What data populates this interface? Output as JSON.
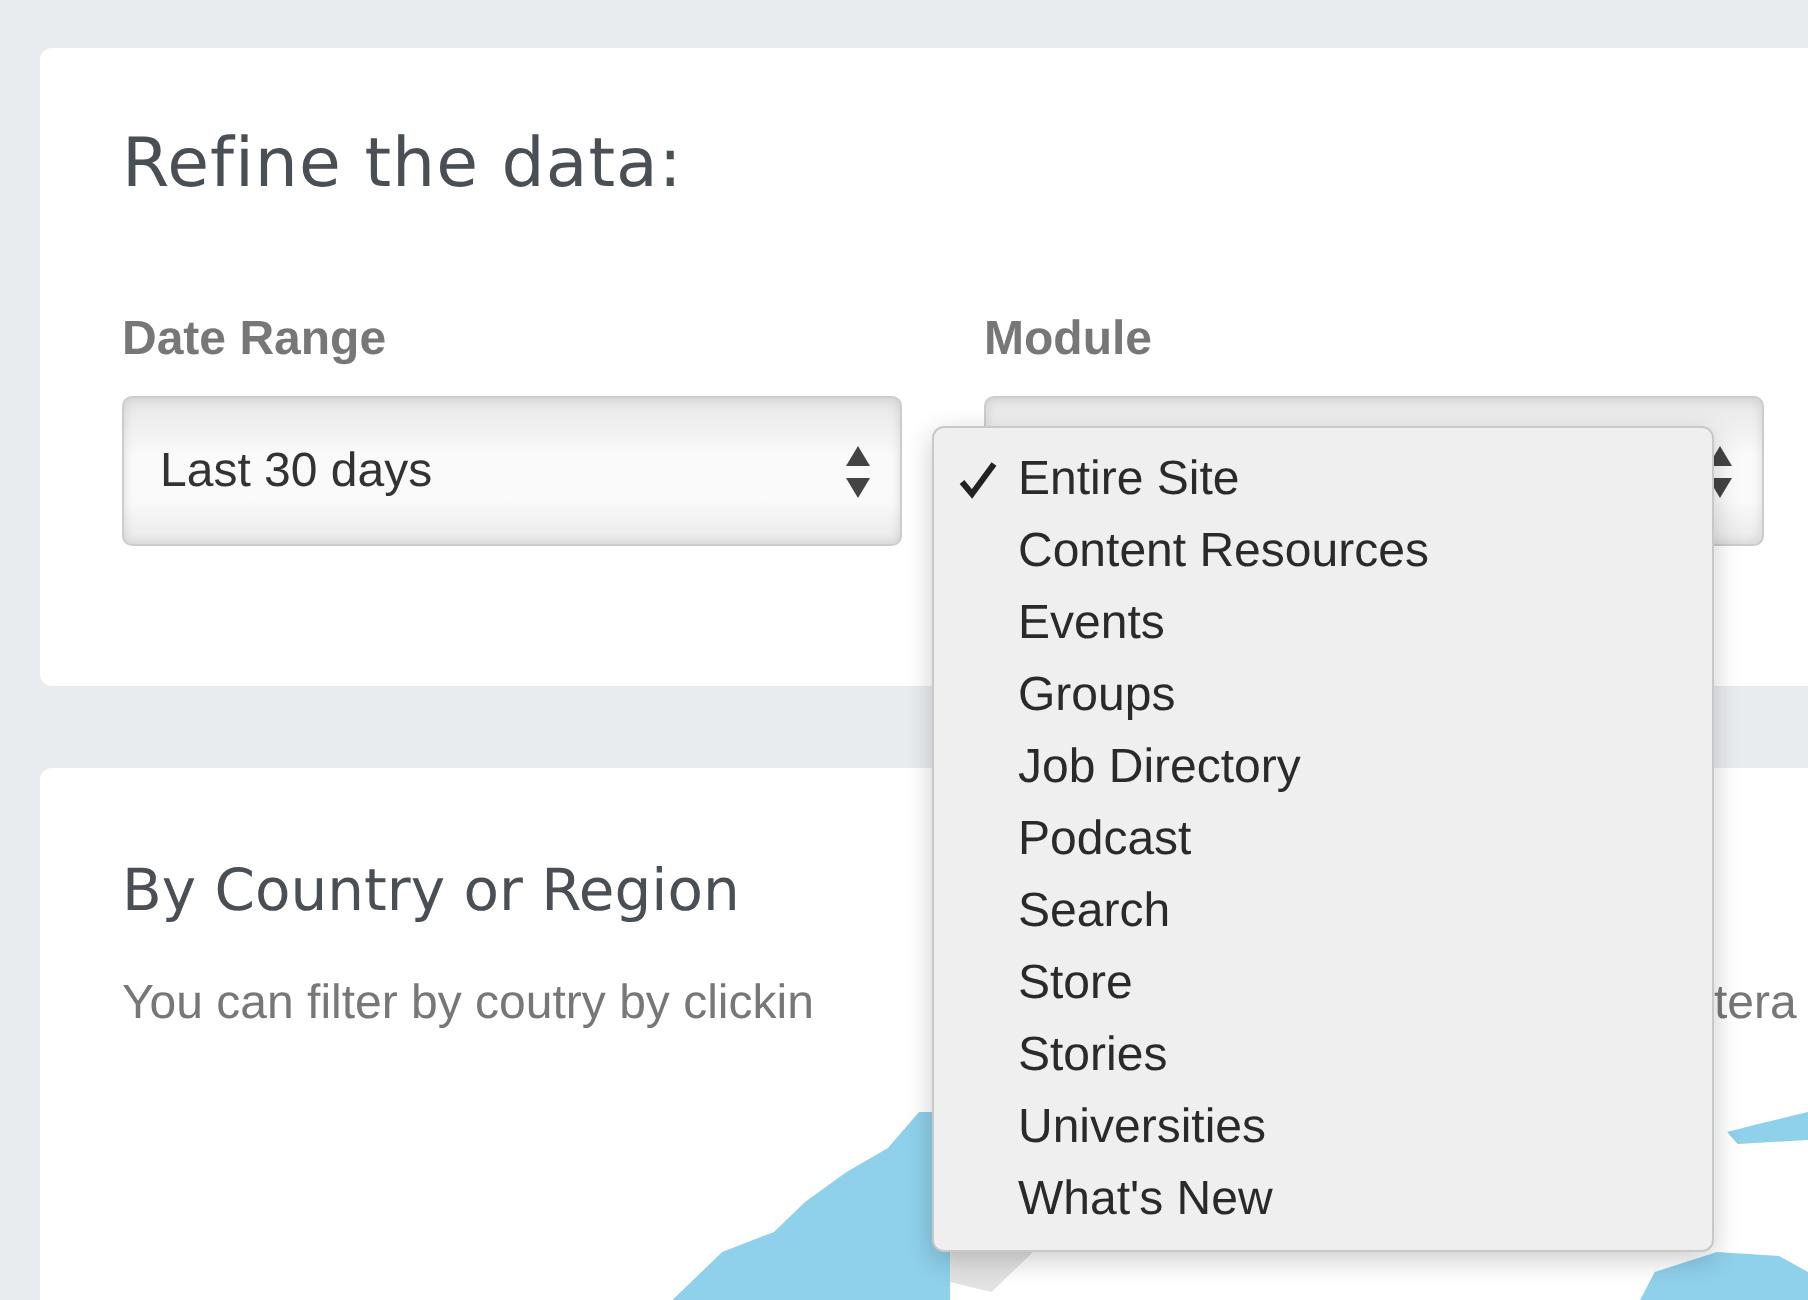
{
  "filters_card": {
    "title": "Refine the data:",
    "fields": [
      {
        "label": "Date Range",
        "value": "Last 30 days"
      },
      {
        "label": "Module"
      }
    ]
  },
  "module_menu": {
    "items": [
      {
        "label": "Entire Site",
        "selected": true
      },
      {
        "label": "Content Resources",
        "selected": false
      },
      {
        "label": "Events",
        "selected": false
      },
      {
        "label": "Groups",
        "selected": false
      },
      {
        "label": "Job Directory",
        "selected": false
      },
      {
        "label": "Podcast",
        "selected": false
      },
      {
        "label": "Search",
        "selected": false
      },
      {
        "label": "Store",
        "selected": false
      },
      {
        "label": "Stories",
        "selected": false
      },
      {
        "label": "Universities",
        "selected": false
      },
      {
        "label": "What's New",
        "selected": false
      }
    ]
  },
  "region_card": {
    "title": "By Country or Region",
    "description_left": "You can filter by coutry by clickin",
    "description_right": "tera"
  }
}
